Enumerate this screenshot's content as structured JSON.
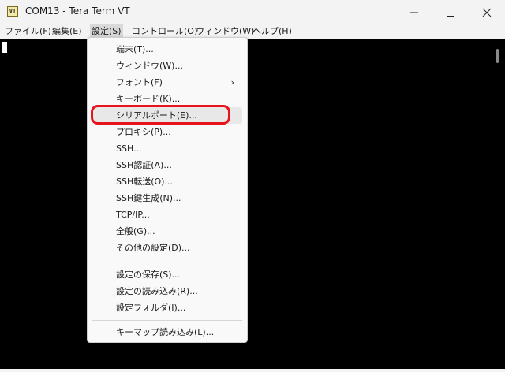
{
  "window": {
    "title": "COM13 - Tera Term VT",
    "icon_text": "VT"
  },
  "menubar": {
    "items": [
      {
        "label": "ファイル(F)"
      },
      {
        "label": "編集(E)"
      },
      {
        "label": "設定(S)"
      },
      {
        "label": "コントロール(O)"
      },
      {
        "label": "ウィンドウ(W)"
      },
      {
        "label": "ヘルプ(H)"
      }
    ]
  },
  "settings_menu": {
    "items": [
      {
        "label": "端末(T)..."
      },
      {
        "label": "ウィンドウ(W)..."
      },
      {
        "label": "フォント(F)",
        "submenu_arrow": "›"
      },
      {
        "label": "キーボード(K)..."
      },
      {
        "label": "シリアルポート(E)..."
      },
      {
        "label": "プロキシ(P)..."
      },
      {
        "label": "SSH..."
      },
      {
        "label": "SSH認証(A)..."
      },
      {
        "label": "SSH転送(O)..."
      },
      {
        "label": "SSH鍵生成(N)..."
      },
      {
        "label": "TCP/IP..."
      },
      {
        "label": "全般(G)..."
      },
      {
        "label": "その他の設定(D)..."
      },
      {
        "label": "設定の保存(S)..."
      },
      {
        "label": "設定の読み込み(R)..."
      },
      {
        "label": "設定フォルダ(I)..."
      },
      {
        "label": "キーマップ読み込み(L)..."
      }
    ]
  },
  "colors": {
    "terminal_background": "#000000",
    "highlight_ring": "#e8141b"
  }
}
